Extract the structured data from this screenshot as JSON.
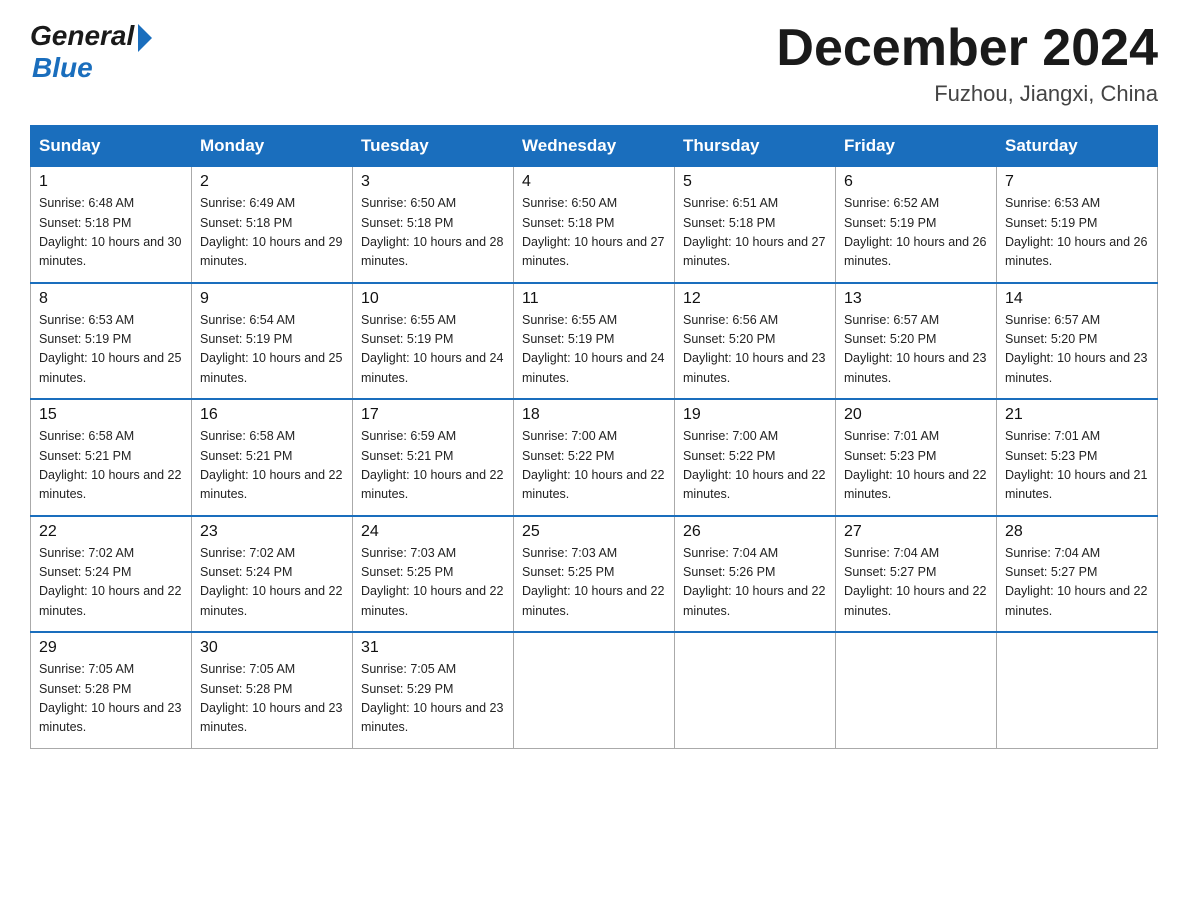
{
  "header": {
    "logo_general": "General",
    "logo_blue": "Blue",
    "month_title": "December 2024",
    "location": "Fuzhou, Jiangxi, China"
  },
  "weekdays": [
    "Sunday",
    "Monday",
    "Tuesday",
    "Wednesday",
    "Thursday",
    "Friday",
    "Saturday"
  ],
  "weeks": [
    [
      {
        "day": "1",
        "sunrise": "6:48 AM",
        "sunset": "5:18 PM",
        "daylight": "10 hours and 30 minutes."
      },
      {
        "day": "2",
        "sunrise": "6:49 AM",
        "sunset": "5:18 PM",
        "daylight": "10 hours and 29 minutes."
      },
      {
        "day": "3",
        "sunrise": "6:50 AM",
        "sunset": "5:18 PM",
        "daylight": "10 hours and 28 minutes."
      },
      {
        "day": "4",
        "sunrise": "6:50 AM",
        "sunset": "5:18 PM",
        "daylight": "10 hours and 27 minutes."
      },
      {
        "day": "5",
        "sunrise": "6:51 AM",
        "sunset": "5:18 PM",
        "daylight": "10 hours and 27 minutes."
      },
      {
        "day": "6",
        "sunrise": "6:52 AM",
        "sunset": "5:19 PM",
        "daylight": "10 hours and 26 minutes."
      },
      {
        "day": "7",
        "sunrise": "6:53 AM",
        "sunset": "5:19 PM",
        "daylight": "10 hours and 26 minutes."
      }
    ],
    [
      {
        "day": "8",
        "sunrise": "6:53 AM",
        "sunset": "5:19 PM",
        "daylight": "10 hours and 25 minutes."
      },
      {
        "day": "9",
        "sunrise": "6:54 AM",
        "sunset": "5:19 PM",
        "daylight": "10 hours and 25 minutes."
      },
      {
        "day": "10",
        "sunrise": "6:55 AM",
        "sunset": "5:19 PM",
        "daylight": "10 hours and 24 minutes."
      },
      {
        "day": "11",
        "sunrise": "6:55 AM",
        "sunset": "5:19 PM",
        "daylight": "10 hours and 24 minutes."
      },
      {
        "day": "12",
        "sunrise": "6:56 AM",
        "sunset": "5:20 PM",
        "daylight": "10 hours and 23 minutes."
      },
      {
        "day": "13",
        "sunrise": "6:57 AM",
        "sunset": "5:20 PM",
        "daylight": "10 hours and 23 minutes."
      },
      {
        "day": "14",
        "sunrise": "6:57 AM",
        "sunset": "5:20 PM",
        "daylight": "10 hours and 23 minutes."
      }
    ],
    [
      {
        "day": "15",
        "sunrise": "6:58 AM",
        "sunset": "5:21 PM",
        "daylight": "10 hours and 22 minutes."
      },
      {
        "day": "16",
        "sunrise": "6:58 AM",
        "sunset": "5:21 PM",
        "daylight": "10 hours and 22 minutes."
      },
      {
        "day": "17",
        "sunrise": "6:59 AM",
        "sunset": "5:21 PM",
        "daylight": "10 hours and 22 minutes."
      },
      {
        "day": "18",
        "sunrise": "7:00 AM",
        "sunset": "5:22 PM",
        "daylight": "10 hours and 22 minutes."
      },
      {
        "day": "19",
        "sunrise": "7:00 AM",
        "sunset": "5:22 PM",
        "daylight": "10 hours and 22 minutes."
      },
      {
        "day": "20",
        "sunrise": "7:01 AM",
        "sunset": "5:23 PM",
        "daylight": "10 hours and 22 minutes."
      },
      {
        "day": "21",
        "sunrise": "7:01 AM",
        "sunset": "5:23 PM",
        "daylight": "10 hours and 21 minutes."
      }
    ],
    [
      {
        "day": "22",
        "sunrise": "7:02 AM",
        "sunset": "5:24 PM",
        "daylight": "10 hours and 22 minutes."
      },
      {
        "day": "23",
        "sunrise": "7:02 AM",
        "sunset": "5:24 PM",
        "daylight": "10 hours and 22 minutes."
      },
      {
        "day": "24",
        "sunrise": "7:03 AM",
        "sunset": "5:25 PM",
        "daylight": "10 hours and 22 minutes."
      },
      {
        "day": "25",
        "sunrise": "7:03 AM",
        "sunset": "5:25 PM",
        "daylight": "10 hours and 22 minutes."
      },
      {
        "day": "26",
        "sunrise": "7:04 AM",
        "sunset": "5:26 PM",
        "daylight": "10 hours and 22 minutes."
      },
      {
        "day": "27",
        "sunrise": "7:04 AM",
        "sunset": "5:27 PM",
        "daylight": "10 hours and 22 minutes."
      },
      {
        "day": "28",
        "sunrise": "7:04 AM",
        "sunset": "5:27 PM",
        "daylight": "10 hours and 22 minutes."
      }
    ],
    [
      {
        "day": "29",
        "sunrise": "7:05 AM",
        "sunset": "5:28 PM",
        "daylight": "10 hours and 23 minutes."
      },
      {
        "day": "30",
        "sunrise": "7:05 AM",
        "sunset": "5:28 PM",
        "daylight": "10 hours and 23 minutes."
      },
      {
        "day": "31",
        "sunrise": "7:05 AM",
        "sunset": "5:29 PM",
        "daylight": "10 hours and 23 minutes."
      },
      null,
      null,
      null,
      null
    ]
  ]
}
